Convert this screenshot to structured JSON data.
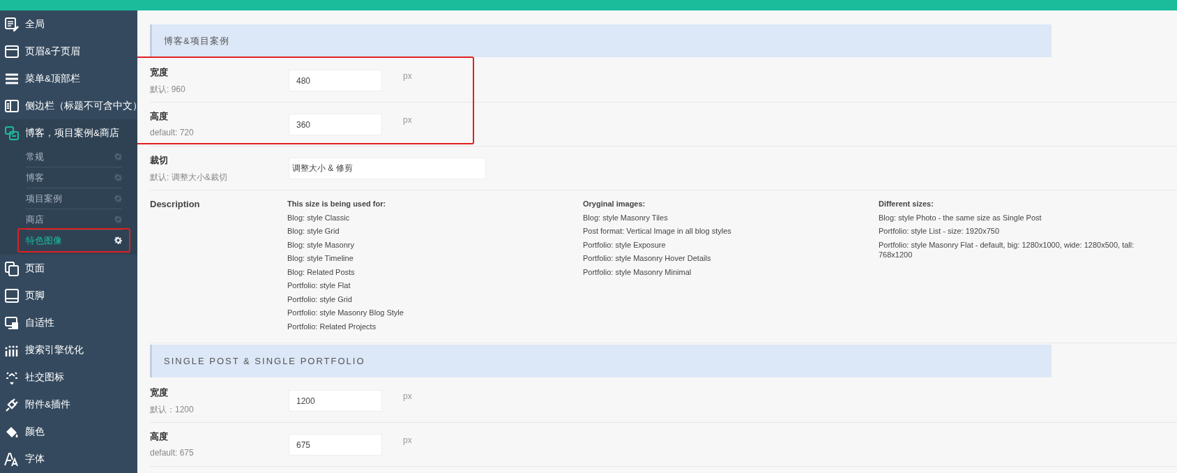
{
  "sidebar": {
    "items": [
      {
        "label": "全局",
        "expanded": false
      },
      {
        "label": "页眉&子页眉",
        "expanded": false
      },
      {
        "label": "菜单&顶部栏",
        "expanded": false
      },
      {
        "label": "侧边栏（标题不可含中文）",
        "expanded": false
      },
      {
        "label": "博客，项目案例&商店",
        "expanded": true,
        "children": [
          {
            "label": "常规",
            "selected": false,
            "highlighted": false
          },
          {
            "label": "博客",
            "selected": false,
            "highlighted": false
          },
          {
            "label": "项目案例",
            "selected": false,
            "highlighted": false
          },
          {
            "label": "商店",
            "selected": false,
            "highlighted": false
          },
          {
            "label": "特色图像",
            "selected": true,
            "highlighted": true
          }
        ]
      },
      {
        "label": "页面",
        "expanded": false
      },
      {
        "label": "页脚",
        "expanded": false
      },
      {
        "label": "自适性",
        "expanded": false
      },
      {
        "label": "搜索引擎优化",
        "expanded": false
      },
      {
        "label": "社交图标",
        "expanded": false
      },
      {
        "label": "附件&插件",
        "expanded": false
      },
      {
        "label": "颜色",
        "expanded": false
      },
      {
        "label": "字体",
        "expanded": false
      }
    ]
  },
  "sections": [
    {
      "title": "博客&项目案例",
      "fields": [
        {
          "kind": "number",
          "label": "宽度",
          "hint": "默认: 960",
          "value": "480",
          "unit": "px",
          "highlighted": true
        },
        {
          "kind": "number",
          "label": "高度",
          "hint": "default: 720",
          "value": "360",
          "unit": "px",
          "highlighted": true
        },
        {
          "kind": "text",
          "label": "裁切",
          "hint": "默认: 调整大小&裁切",
          "value": "调整大小 & 修剪",
          "highlighted": false
        },
        {
          "kind": "description",
          "label": "Description",
          "highlighted": false,
          "columns": [
            {
              "heading": "This size is being used for:",
              "lines": [
                "Blog: style Classic",
                "Blog: style Grid",
                "Blog: style Masonry",
                "Blog: style Timeline",
                "Blog: Related Posts",
                "Portfolio: style Flat",
                "Portfolio: style Grid",
                "Portfolio: style Masonry Blog Style",
                "Portfolio: Related Projects"
              ]
            },
            {
              "heading": "Oryginal images:",
              "lines": [
                "Blog: style Masonry Tiles",
                "Post format: Vertical Image in all blog styles",
                "Portfolio: style Exposure",
                "Portfolio: style Masonry Hover Details",
                "Portfolio: style Masonry Minimal"
              ]
            },
            {
              "heading": "Different sizes:",
              "lines": [
                "Blog: style Photo - the same size as Single Post",
                "Portfolio: style List - size: 1920x750",
                "Portfolio: style Masonry Flat - default, big: 1280x1000, wide: 1280x500, tall: 768x1200"
              ]
            }
          ]
        }
      ]
    },
    {
      "title": "SINGLE POST & SINGLE PORTFOLIO",
      "fields": [
        {
          "kind": "number",
          "label": "宽度",
          "hint": "默认：1200",
          "value": "1200",
          "unit": "px",
          "highlighted": false
        },
        {
          "kind": "number",
          "label": "高度",
          "hint": "default: 675",
          "value": "675",
          "unit": "px",
          "highlighted": false
        }
      ]
    }
  ]
}
